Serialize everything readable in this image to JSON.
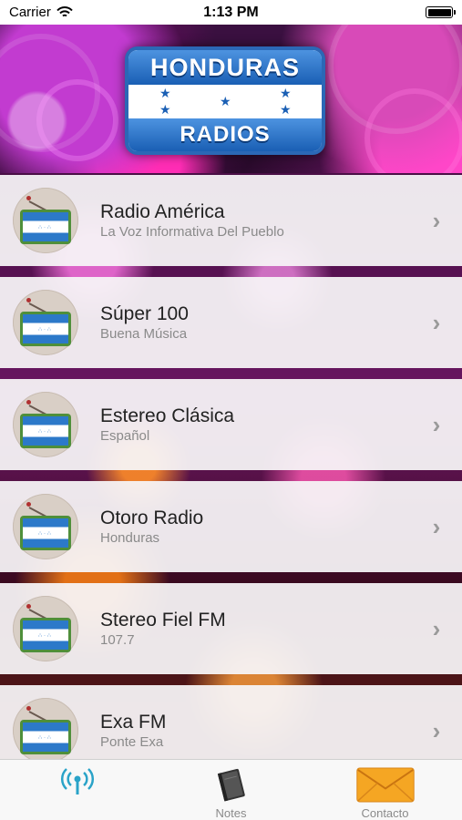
{
  "status_bar": {
    "carrier": "Carrier",
    "time": "1:13 PM"
  },
  "banner": {
    "logo_top": "HONDURAS",
    "logo_bottom": "RADIOS"
  },
  "stations": [
    {
      "name": "Radio América",
      "subtitle": "La Voz Informativa Del Pueblo"
    },
    {
      "name": "Súper 100",
      "subtitle": "Buena Música"
    },
    {
      "name": "Estereo Clásica",
      "subtitle": "Español"
    },
    {
      "name": "Otoro Radio",
      "subtitle": "Honduras"
    },
    {
      "name": "Stereo Fiel FM",
      "subtitle": "107.7"
    },
    {
      "name": "Exa FM",
      "subtitle": "Ponte Exa"
    }
  ],
  "tabbar": {
    "tabs": [
      {
        "label": "",
        "icon": "radio-signal-icon"
      },
      {
        "label": "Notes",
        "icon": "notebook-icon"
      },
      {
        "label": "Contacto",
        "icon": "envelope-icon"
      }
    ]
  },
  "colors": {
    "active_tab": "#2aa3c8",
    "flag_blue": "#2c79c9",
    "logo_blue": "#1a5fb4"
  }
}
